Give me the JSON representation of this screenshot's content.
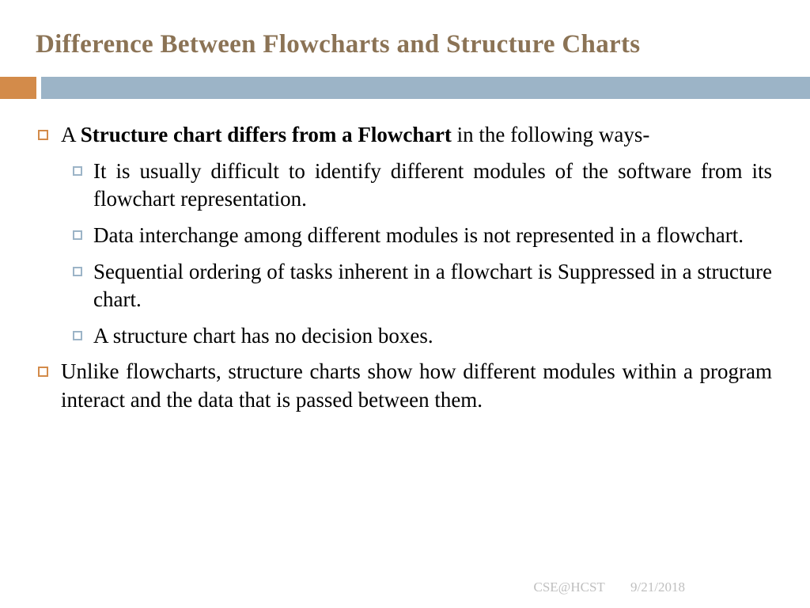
{
  "title": "Difference Between Flowcharts and Structure Charts",
  "intro_bold": "Structure chart differs from a Flowchart",
  "intro_prefix": "A ",
  "intro_suffix": " in the following ways-",
  "sub": [
    "It is usually difficult to identify different modules of the software from its flowchart representation.",
    "Data interchange among different modules is not represented in a flowchart.",
    "Sequential ordering of tasks inherent in a flowchart is Suppressed in a structure chart.",
    "A structure chart has no decision boxes."
  ],
  "outro": "Unlike flowcharts, structure charts show how different modules within a program interact and the data that is passed between them.",
  "footer": {
    "src": "CSE@HCST",
    "date": "9/21/2018"
  }
}
